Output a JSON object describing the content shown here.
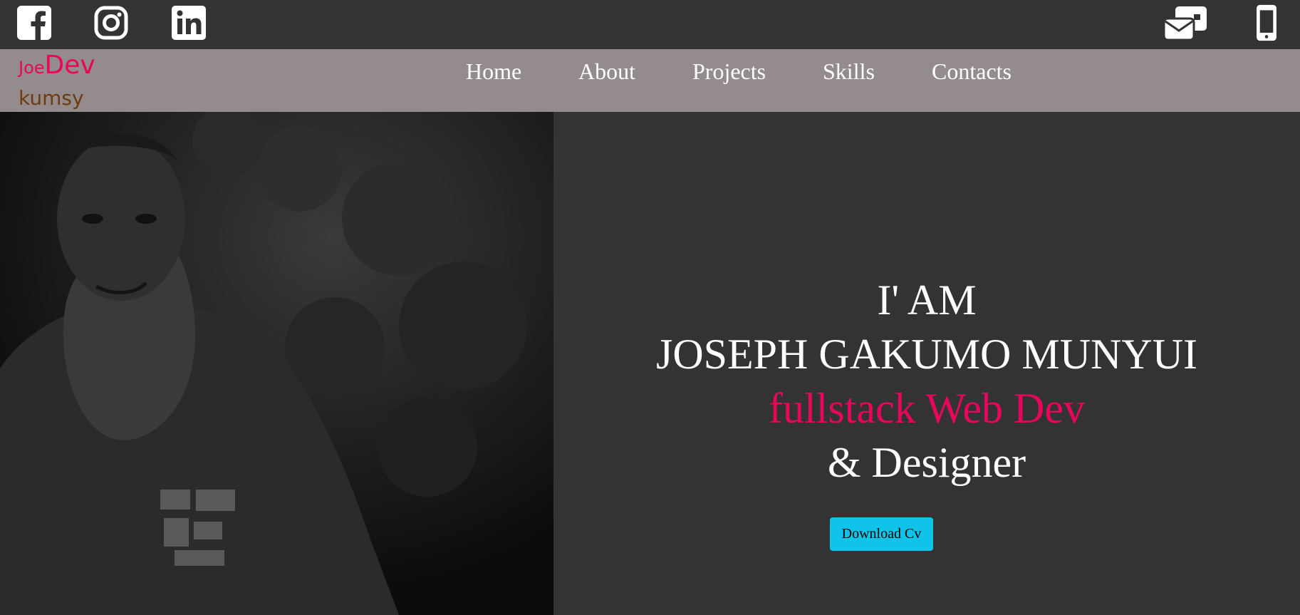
{
  "header": {
    "social_icons": [
      "facebook-icon",
      "instagram-icon",
      "linkedin-icon"
    ],
    "contact_icons": [
      "mail-icon",
      "phone-icon"
    ]
  },
  "logo": {
    "part1": "Joe",
    "part2": "Dev",
    "sub": "kumsy"
  },
  "nav": {
    "items": [
      {
        "label": "Home"
      },
      {
        "label": "About"
      },
      {
        "label": "Projects"
      },
      {
        "label": "Skills"
      },
      {
        "label": "Contacts"
      }
    ]
  },
  "hero": {
    "line1": "I' AM",
    "line2": "JOSEPH GAKUMO MUNYUI",
    "line3": "fullstack Web Dev",
    "line4": "& Designer",
    "button_label": "Download Cv"
  },
  "colors": {
    "accent": "#e8065b",
    "nav_bg": "#948b8c",
    "page_bg": "#333333",
    "button_bg": "#0fc4e8",
    "logo_sub": "#6e3b12"
  }
}
